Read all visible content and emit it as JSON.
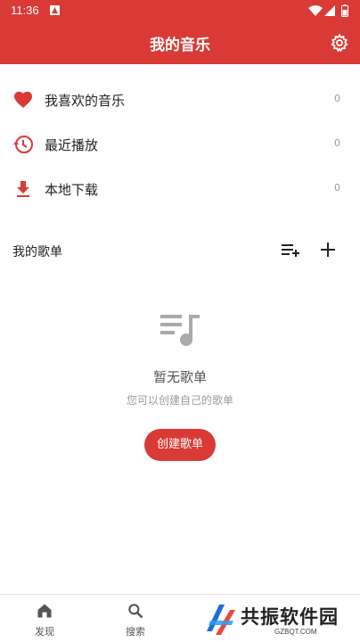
{
  "status_bar": {
    "time": "11:36"
  },
  "app_bar": {
    "title": "我的音乐"
  },
  "menu": [
    {
      "label": "我喜欢的音乐",
      "count": "0",
      "icon": "heart-icon"
    },
    {
      "label": "最近播放",
      "count": "0",
      "icon": "history-icon"
    },
    {
      "label": "本地下载",
      "count": "0",
      "icon": "download-icon"
    }
  ],
  "playlists": {
    "title": "我的歌单",
    "empty_title": "暂无歌单",
    "empty_subtitle": "您可以创建自己的歌单",
    "create_label": "创建歌单"
  },
  "bottom_nav": [
    {
      "label": "发现",
      "icon": "home-icon"
    },
    {
      "label": "搜索",
      "icon": "search-icon"
    }
  ],
  "watermark": {
    "name": "共振软件园",
    "url": "GZBQT.COM"
  },
  "colors": {
    "accent": "#d93a35"
  }
}
